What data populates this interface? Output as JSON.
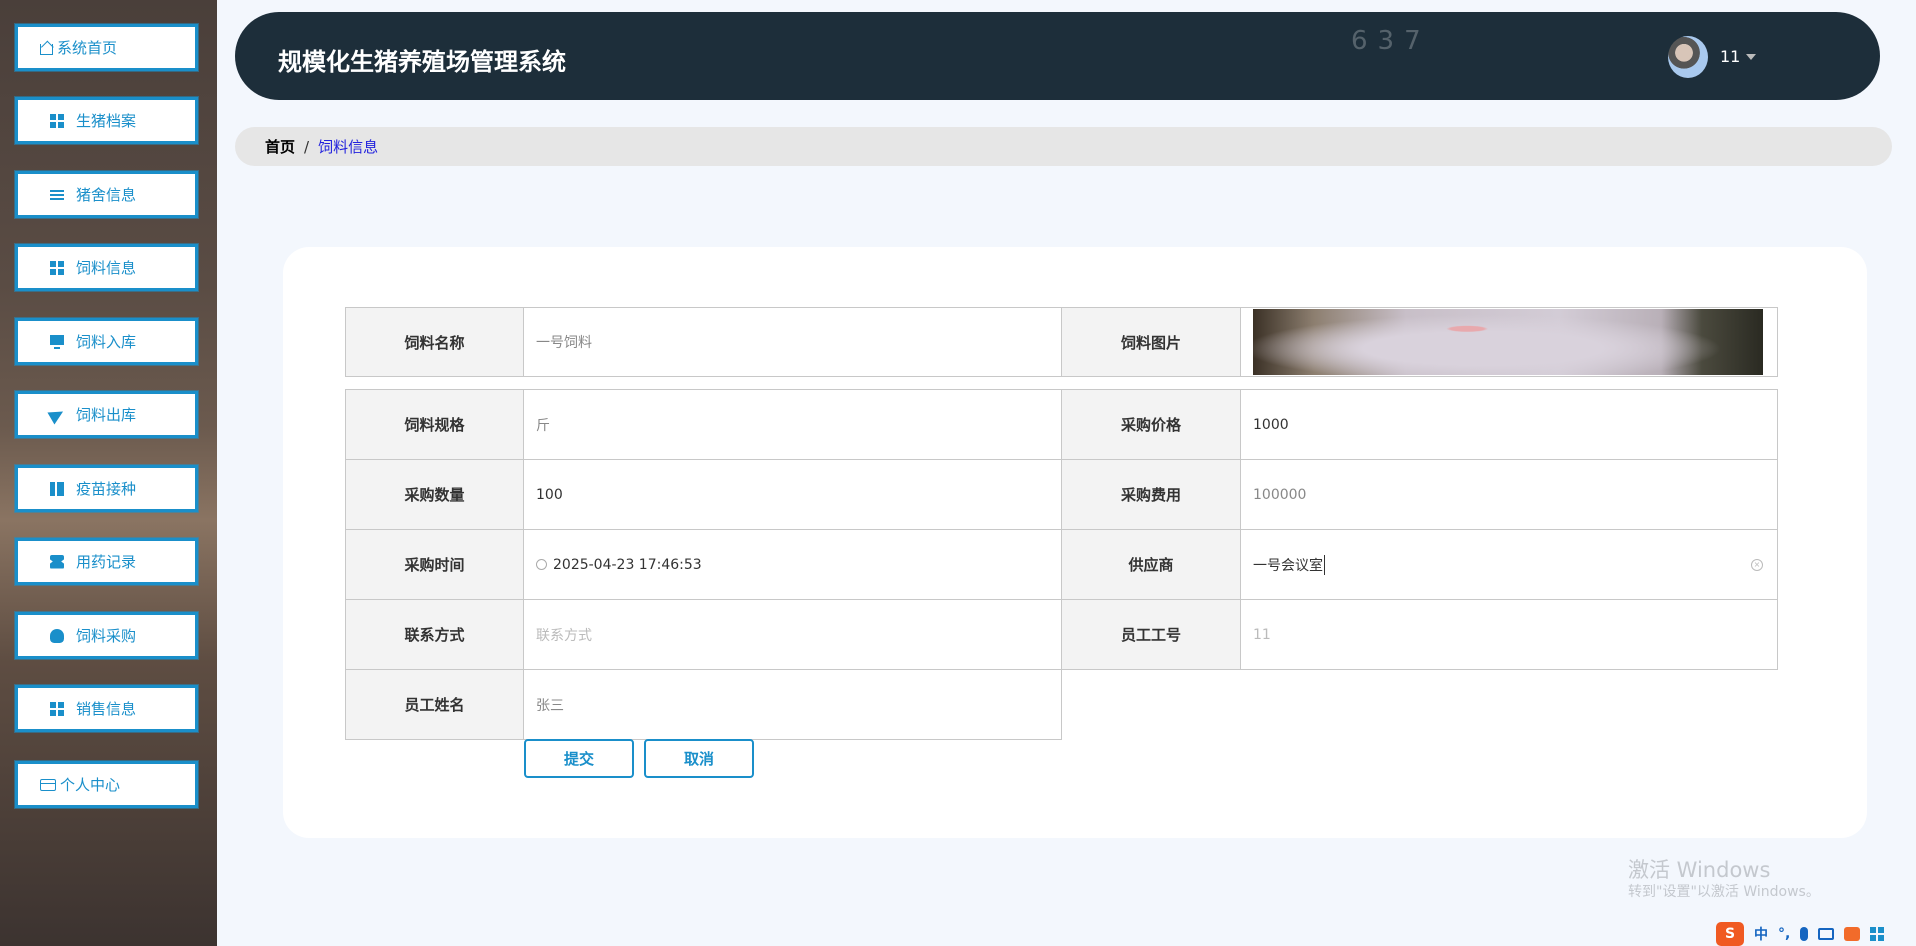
{
  "sidebar": {
    "items": [
      {
        "label": "系统首页",
        "icon": "home-icon"
      },
      {
        "label": "生猪档案",
        "icon": "grid-icon"
      },
      {
        "label": "猪舍信息",
        "icon": "list-icon"
      },
      {
        "label": "饲料信息",
        "icon": "grid-icon"
      },
      {
        "label": "饲料入库",
        "icon": "monitor-icon"
      },
      {
        "label": "饲料出库",
        "icon": "send-icon"
      },
      {
        "label": "疫苗接种",
        "icon": "book-icon"
      },
      {
        "label": "用药记录",
        "icon": "ticket-icon"
      },
      {
        "label": "饲料采购",
        "icon": "bulb-icon"
      },
      {
        "label": "销售信息",
        "icon": "grid-icon"
      },
      {
        "label": "个人中心",
        "icon": "card-icon"
      }
    ]
  },
  "header": {
    "title": "规模化生猪养殖场管理系统",
    "deco_text": "637",
    "username": "11"
  },
  "breadcrumb": {
    "home": "首页",
    "separator": "/",
    "current": "饲料信息"
  },
  "form": {
    "name": {
      "label": "饲料名称",
      "value": "一号饲料"
    },
    "image": {
      "label": "饲料图片"
    },
    "spec": {
      "label": "饲料规格",
      "value": "斤"
    },
    "price": {
      "label": "采购价格",
      "value": "1000"
    },
    "quantity": {
      "label": "采购数量",
      "value": "100"
    },
    "cost": {
      "label": "采购费用",
      "value": "100000"
    },
    "time": {
      "label": "采购时间",
      "value": "2025-04-23 17:46:53"
    },
    "supplier": {
      "label": "供应商",
      "value": "一号会议室"
    },
    "contact": {
      "label": "联系方式",
      "placeholder": "联系方式"
    },
    "staff_no": {
      "label": "员工工号",
      "value": "11"
    },
    "staff_name": {
      "label": "员工姓名",
      "value": "张三"
    },
    "submit": "提交",
    "cancel": "取消"
  },
  "watermark": {
    "line1": "激活 Windows",
    "line2": "转到\"设置\"以激活 Windows。"
  },
  "tray": {
    "ime_logo": "S",
    "ime_mode": "中",
    "punct": "°,"
  }
}
